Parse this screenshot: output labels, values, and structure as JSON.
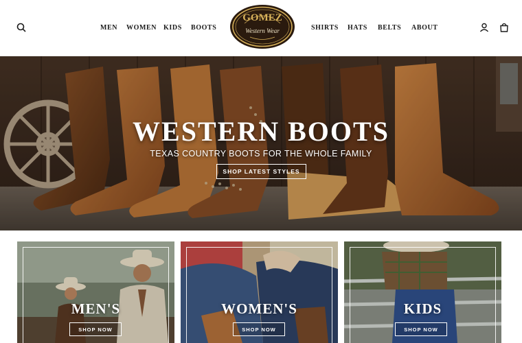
{
  "header": {
    "search_icon": "search-icon",
    "nav_left": [
      "MEN",
      "WOMEN",
      "KIDS",
      "BOOTS"
    ],
    "nav_right": [
      "SHIRTS",
      "HATS",
      "BELTS",
      "ABOUT"
    ],
    "logo": {
      "brand": "GOMEZ",
      "tagline": "Western Wear"
    },
    "account_icon": "user-icon",
    "cart_icon": "cart-icon"
  },
  "hero": {
    "title": "WESTERN BOOTS",
    "subtitle": "TEXAS COUNTRY BOOTS FOR THE WHOLE FAMILY",
    "cta": "SHOP LATEST STYLES"
  },
  "categories": [
    {
      "title": "MEN'S",
      "cta": "SHOP NOW"
    },
    {
      "title": "WOMEN'S",
      "cta": "SHOP NOW"
    },
    {
      "title": "KIDS",
      "cta": "SHOP NOW"
    }
  ],
  "colors": {
    "accent": "#1a1a1a",
    "logo_gold": "#d8b25a",
    "logo_dark": "#2a1a0e",
    "boot_tan": "#c77a35"
  }
}
